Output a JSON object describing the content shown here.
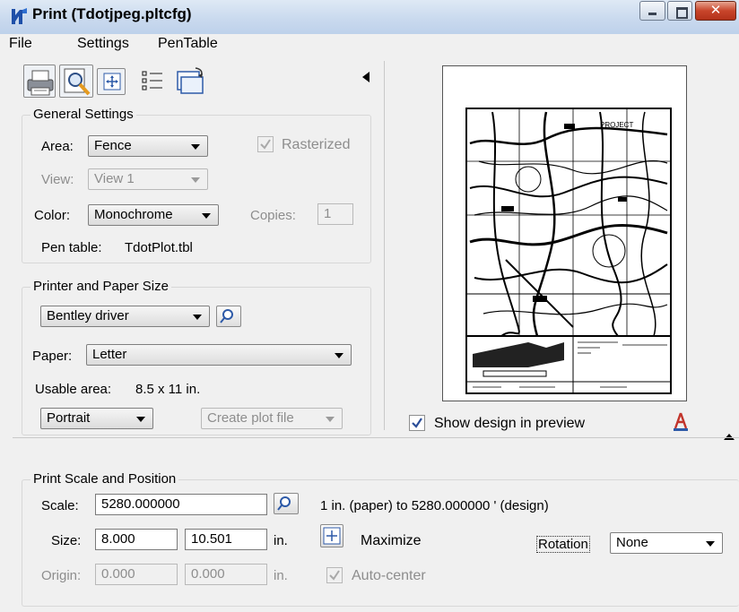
{
  "window": {
    "title": "Print  (Tdotjpeg.pltcfg)"
  },
  "menu": [
    "File",
    "Settings",
    "PenTable"
  ],
  "toolbar": {
    "icons": [
      "printer-icon",
      "preview-magnify-icon",
      "fit-icon",
      "list-icon",
      "rotate-sheet-icon"
    ]
  },
  "general": {
    "title": "General Settings",
    "area_label": "Area:",
    "area_value": "Fence",
    "rasterized_label": "Rasterized",
    "view_label": "View:",
    "view_value": "View 1",
    "color_label": "Color:",
    "color_value": "Monochrome",
    "copies_label": "Copies:",
    "copies_value": "1",
    "pentable_label": "Pen table:",
    "pentable_value": "TdotPlot.tbl"
  },
  "printer": {
    "title": "Printer and Paper Size",
    "driver_value": "Bentley driver",
    "paper_label": "Paper:",
    "paper_value": "Letter",
    "usable_label": "Usable area:",
    "usable_value": "8.5 x 11 in.",
    "orientation_value": "Portrait",
    "output_value": "Create plot file"
  },
  "preview": {
    "show_label": "Show design in preview",
    "map_label": "PROJECT"
  },
  "scale": {
    "title": "Print Scale and Position",
    "scale_label": "Scale:",
    "scale_value": "5280.000000",
    "scale_desc": "1 in. (paper) to 5280.000000 ' (design)",
    "size_label": "Size:",
    "size_w": "8.000",
    "size_h": "10.501",
    "unit": "in.",
    "maximize_label": "Maximize",
    "rotation_label": "Rotation",
    "rotation_value": "None",
    "origin_label": "Origin:",
    "origin_x": "0.000",
    "origin_y": "0.000",
    "origin_unit": "in.",
    "autocenter_label": "Auto-center"
  }
}
